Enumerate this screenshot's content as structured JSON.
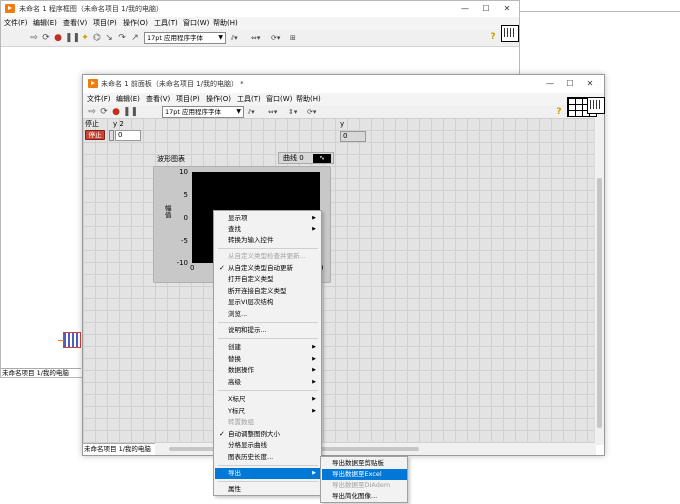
{
  "block_diagram": {
    "title": "未命名 1 程序框图（未命名项目 1/我的电脑）",
    "menu": [
      "文件(F)",
      "编辑(E)",
      "查看(V)",
      "项目(P)",
      "操作(O)",
      "工具(T)",
      "窗口(W)",
      "帮助(H)"
    ],
    "font_select": "17pt 应用程序字体",
    "status": "未命名项目 1/我的电脑",
    "help": "?"
  },
  "front_panel": {
    "title": "未命名 1 前面板（未命名项目 1/我的电脑） *",
    "menu": [
      "文件(F)",
      "编辑(E)",
      "查看(V)",
      "项目(P)",
      "操作(O)",
      "工具(T)",
      "窗口(W)",
      "帮助(H)"
    ],
    "font_select": "17pt 应用程序字体",
    "status": "未命名项目 1/我的电脑",
    "help": "?",
    "stop_label": "停止",
    "stop_button": "停止",
    "y2_label": "y 2",
    "y2_value": "0",
    "y_label": "y",
    "y_value": "0",
    "chart": {
      "label": "波形图表",
      "legend": "曲线 0",
      "ylabel": "幅值",
      "yticks": [
        "10",
        "5",
        "0",
        "-5",
        "-10"
      ],
      "xticks": [
        "0",
        "0"
      ]
    }
  },
  "window_buttons": {
    "minimize": "—",
    "maximize": "☐",
    "close": "✕"
  },
  "context_menu": {
    "items": [
      {
        "label": "显示项",
        "submenu": true
      },
      {
        "label": "查找",
        "submenu": true
      },
      {
        "label": "转换为输入控件"
      },
      {
        "label": "从自定义类型检查并更新...",
        "disabled": true
      },
      {
        "label": "从自定义类型自动更新",
        "checked": true
      },
      {
        "label": "打开自定义类型"
      },
      {
        "label": "断开连接自定义类型"
      },
      {
        "label": "显示VI层次结构"
      },
      {
        "label": "浏览..."
      },
      {
        "label": "说明和提示..."
      },
      {
        "label": "创建",
        "submenu": true
      },
      {
        "label": "替换",
        "submenu": true
      },
      {
        "label": "数据操作",
        "submenu": true
      },
      {
        "label": "高级",
        "submenu": true
      },
      {
        "label": "X标尺",
        "submenu": true
      },
      {
        "label": "Y标尺",
        "submenu": true
      },
      {
        "label": "转置数组",
        "disabled": true
      },
      {
        "label": "自动调整图例大小",
        "checked": true
      },
      {
        "label": "分格显示曲线"
      },
      {
        "label": "图表历史长度..."
      },
      {
        "label": "导出",
        "submenu": true,
        "active": true
      },
      {
        "label": "属性"
      }
    ],
    "export_submenu": [
      {
        "label": "导出数据至剪贴板"
      },
      {
        "label": "导出数据至Excel",
        "active": true
      },
      {
        "label": "导出数据至DIAdem",
        "disabled": true
      },
      {
        "label": "导出简化图像..."
      }
    ]
  }
}
